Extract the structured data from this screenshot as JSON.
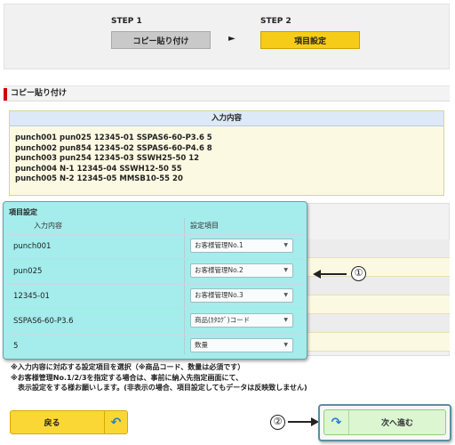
{
  "steps": {
    "step1_label": "STEP 1",
    "step1_name": "コピー貼り付け",
    "step2_label": "STEP 2",
    "step2_name": "項目設定",
    "arrow": "►"
  },
  "section": {
    "title": "コピー貼り付け"
  },
  "input_box": {
    "header": "入力内容",
    "lines": [
      "punch001 pun025 12345-01 SSPAS6-60-P3.6 5",
      "punch002 pun854 12345-02 SSPAS6-60-P4.6 8",
      "punch003 pun254 12345-03 SSWH25-50 12",
      "punch004 N-1 12345-04 SSWH12-50 55",
      "punch005 N-2 12345-05 MMSB10-55 20"
    ]
  },
  "panel": {
    "title": "項目設定",
    "col_input": "入力内容",
    "col_setting": "設定項目",
    "rows": [
      {
        "value": "punch001",
        "setting": "お客様管理No.1"
      },
      {
        "value": "pun025",
        "setting": "お客様管理No.2"
      },
      {
        "value": "12345-01",
        "setting": "お客様管理No.3"
      },
      {
        "value": "SSPAS6-60-P3.6",
        "setting": "商品(ｶﾀﾛｸﾞ)コード"
      },
      {
        "value": "5",
        "setting": "数量"
      }
    ]
  },
  "annotations": {
    "callout1": "①",
    "callout2": "②"
  },
  "notes": [
    "※入力内容に対応する設定項目を選択（※商品コード、数量は必須です）",
    "※お客様管理No.1/2/3を指定する場合は、事前に納入先指定画面にて、",
    "　表示設定をする様お願いします。(非表示の場合、項目設定してもデータは反映致しません)"
  ],
  "buttons": {
    "back": "戻る",
    "next": "次へ進む"
  },
  "colors": {
    "step2_accent": "#f7cc19",
    "section_marker": "#d40000",
    "panel_bg": "#a5ecec",
    "next_button": "#dbf6d1",
    "back_button": "#fbd735"
  }
}
